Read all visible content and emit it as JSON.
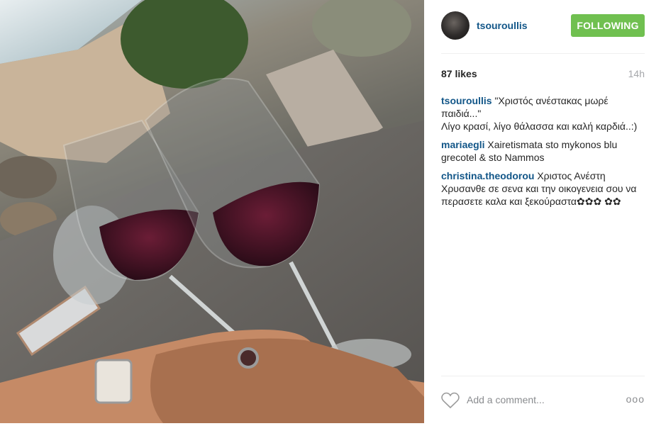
{
  "post": {
    "photo_alt": "photo"
  },
  "header": {
    "username": "tsouroullis",
    "follow_label": "FOLLOWING"
  },
  "stats": {
    "likes": "87 likes",
    "time": "14h"
  },
  "comments": [
    {
      "user": "tsouroullis",
      "text": " \"Χριστός ανέστακας μωρέ παιδιά...\"\nΛίγο κρασί, λίγο θάλασσα και καλή καρδιά..:)"
    },
    {
      "user": "mariaegli",
      "text": " Xairetismata sto mykonos blu grecotel & sto Nammos"
    },
    {
      "user": "christina.theodorou",
      "text": " Χριστος Ανέστη Χρυσανθε σε σενα και την οικογενεια σου να περασετε καλα και ξεκούραστα✿✿✿ ✿✿"
    }
  ],
  "footer": {
    "comment_placeholder": "Add a comment...",
    "more_label": "ooo"
  },
  "colors": {
    "link": "#125688",
    "follow": "#70c050",
    "muted": "#a5a7aa"
  }
}
